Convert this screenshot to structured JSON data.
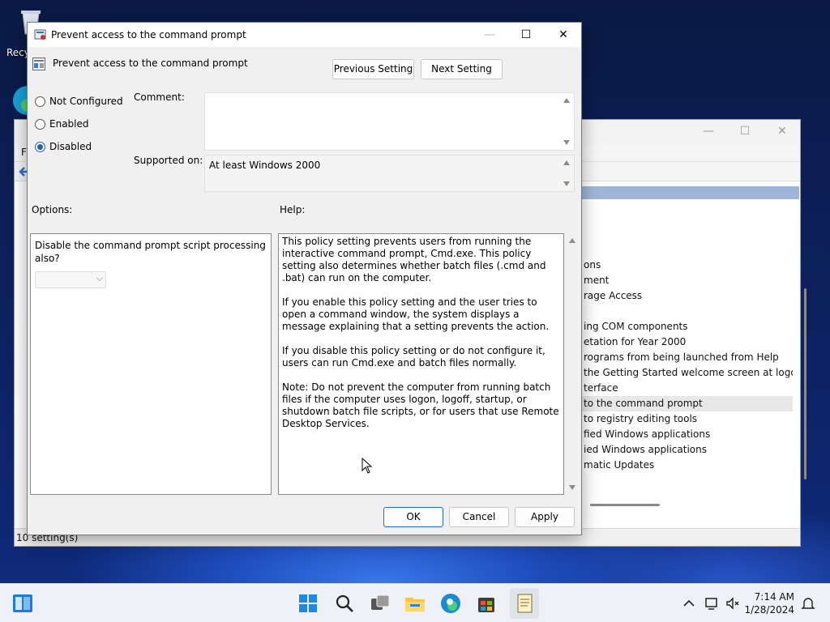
{
  "desktop": {
    "icons": [
      {
        "label": "Recy"
      }
    ]
  },
  "background_window": {
    "menu_fragment": "F",
    "list_items": [
      {
        "label": "ons"
      },
      {
        "label": "ment"
      },
      {
        "label": "rage Access"
      },
      {
        "label": ""
      },
      {
        "label": "ing COM components"
      },
      {
        "label": "etation for Year 2000"
      },
      {
        "label": "rograms from being launched from Help"
      },
      {
        "label": "the Getting Started welcome screen at logon"
      },
      {
        "label": "terface"
      },
      {
        "label": "to the command prompt",
        "selected": true
      },
      {
        "label": "to registry editing tools"
      },
      {
        "label": "fied Windows applications"
      },
      {
        "label": "ied Windows applications"
      },
      {
        "label": "matic Updates"
      }
    ],
    "status": "10 setting(s)"
  },
  "dialog": {
    "title": "Prevent access to the command prompt",
    "header_title": "Prevent access to the command prompt",
    "buttons": {
      "previous": "Previous Setting",
      "next": "Next Setting",
      "ok": "OK",
      "cancel": "Cancel",
      "apply": "Apply"
    },
    "radios": {
      "not_configured": "Not Configured",
      "enabled": "Enabled",
      "disabled": "Disabled",
      "selected": "disabled"
    },
    "comment_label": "Comment:",
    "comment_value": "",
    "supported_label": "Supported on:",
    "supported_value": "At least Windows 2000",
    "options_label": "Options:",
    "help_label": "Help:",
    "options": {
      "text": "Disable the command prompt script processing also?",
      "combo_value": ""
    },
    "help": {
      "p1": "This policy setting prevents users from running the interactive command prompt, Cmd.exe.  This policy setting also determines whether batch files (.cmd and .bat) can run on the computer.",
      "p2": "If you enable this policy setting and the user tries to open a command window, the system displays a message explaining that a setting prevents the action.",
      "p3": "If you disable this policy setting or do not configure it, users can run Cmd.exe and batch files normally.",
      "p4": "Note: Do not prevent the computer from running batch files if the computer uses logon, logoff, startup, or shutdown batch file scripts, or for users that use Remote Desktop Services."
    }
  },
  "taskbar": {
    "time": "7:14 AM",
    "date": "1/28/2024",
    "pinned": [
      "start-icon",
      "search-icon",
      "task-view-icon",
      "file-explorer-icon",
      "edge-icon",
      "store-icon",
      "notepad-icon"
    ]
  },
  "colors": {
    "accent": "#1f5fb8",
    "selection_header": "#9fb6d8"
  }
}
